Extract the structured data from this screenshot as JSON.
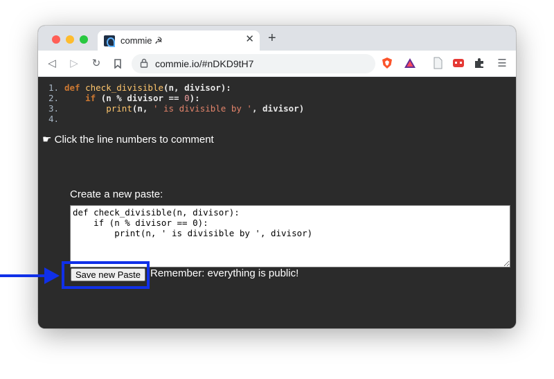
{
  "browser": {
    "tab_title": "commie ☭",
    "tab_close": "✕",
    "new_tab": "+",
    "url": "commie.io/#nDKD9tH7",
    "nav": {
      "back": "◁",
      "forward": "▷",
      "reload": "↻",
      "bookmark": "⌑"
    },
    "menu": "☰"
  },
  "code": {
    "lines": [
      {
        "num": "1.",
        "tokens": [
          {
            "t": "def ",
            "c": "kw"
          },
          {
            "t": "check_divisible",
            "c": "fn"
          },
          {
            "t": "(n, divisor):",
            "c": "plain"
          }
        ]
      },
      {
        "num": "2.",
        "tokens": [
          {
            "t": "    ",
            "c": "plain"
          },
          {
            "t": "if",
            "c": "kw"
          },
          {
            "t": " (n % divisor == ",
            "c": "plain"
          },
          {
            "t": "0",
            "c": "num"
          },
          {
            "t": "):",
            "c": "plain"
          }
        ]
      },
      {
        "num": "3.",
        "tokens": [
          {
            "t": "        ",
            "c": "plain"
          },
          {
            "t": "print",
            "c": "fn"
          },
          {
            "t": "(n, ",
            "c": "plain"
          },
          {
            "t": "' is divisible by '",
            "c": "str"
          },
          {
            "t": ", divisor)",
            "c": "plain"
          }
        ]
      },
      {
        "num": "4.",
        "tokens": []
      }
    ]
  },
  "hint": "☛ Click the line numbers to comment",
  "create_label": "Create a new paste:",
  "paste_text": "def check_divisible(n, divisor):\n    if (n % divisor == 0):\n        print(n, ' is divisible by ', divisor)",
  "save_button": "Save new Paste",
  "remember_text": "Remember: everything is public!",
  "colors": {
    "annotation": "#1030e8",
    "page_bg": "#2b2b2b"
  }
}
